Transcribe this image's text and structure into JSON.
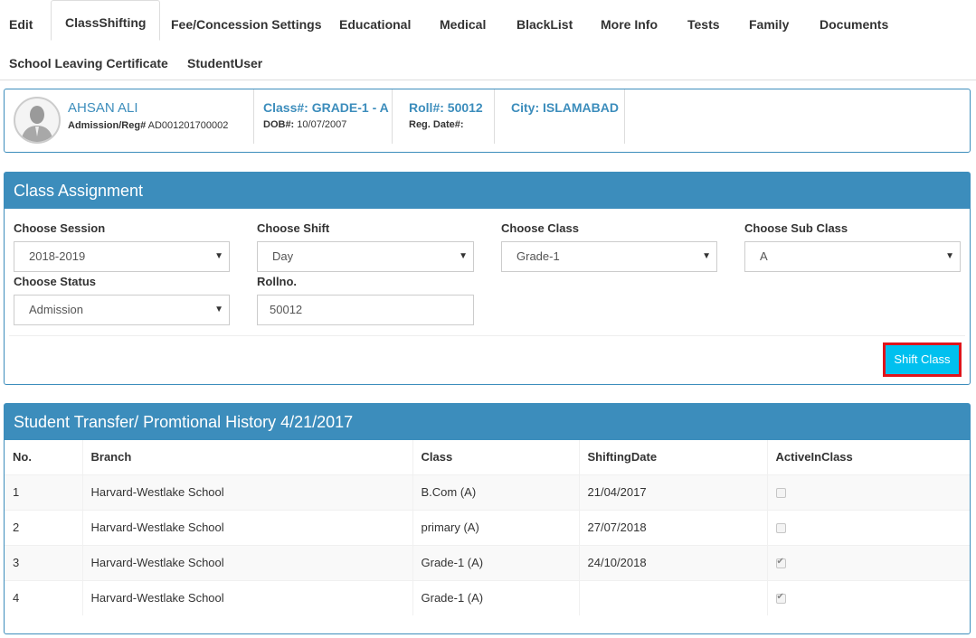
{
  "tabs": [
    {
      "label": "Edit"
    },
    {
      "label": "ClassShifting"
    },
    {
      "label": "Fee/Concession Settings"
    },
    {
      "label": "Educational"
    },
    {
      "label": "Medical"
    },
    {
      "label": "BlackList"
    },
    {
      "label": "More Info"
    },
    {
      "label": "Tests"
    },
    {
      "label": "Family"
    },
    {
      "label": "Documents"
    },
    {
      "label": "School Leaving Certificate"
    },
    {
      "label": "StudentUser"
    }
  ],
  "student": {
    "name": "AHSAN ALI",
    "admission_label": "Admission/Reg#",
    "admission_value": "AD001201700002",
    "class_label": "Class#: GRADE-1 - A",
    "dob_label": "DOB#:",
    "dob_value": "10/07/2007",
    "roll_label": "Roll#: 50012",
    "reg_date_label": "Reg. Date#:",
    "city_label": "City: ISLAMABAD"
  },
  "assignment": {
    "title": "Class Assignment",
    "session_label": "Choose Session",
    "session_value": "2018-2019",
    "shift_label": "Choose Shift",
    "shift_value": "Day",
    "class_label": "Choose Class",
    "class_value": "Grade-1",
    "subclass_label": "Choose Sub Class",
    "subclass_value": "A",
    "status_label": "Choose Status",
    "status_value": "Admission",
    "rollno_label": "Rollno.",
    "rollno_value": "50012",
    "shift_button": "Shift Class"
  },
  "history": {
    "title": "Student Transfer/ Promtional History 4/21/2017",
    "columns": [
      "No.",
      "Branch",
      "Class",
      "ShiftingDate",
      "ActiveInClass"
    ],
    "rows": [
      {
        "no": "1",
        "branch": "Harvard-Westlake School",
        "class": "B.Com (A)",
        "date": "21/04/2017",
        "active": false
      },
      {
        "no": "2",
        "branch": "Harvard-Westlake School",
        "class": "primary (A)",
        "date": "27/07/2018",
        "active": false
      },
      {
        "no": "3",
        "branch": "Harvard-Westlake School",
        "class": "Grade-1 (A)",
        "date": "24/10/2018",
        "active": true
      },
      {
        "no": "4",
        "branch": "Harvard-Westlake School",
        "class": "Grade-1 (A)",
        "date": "",
        "active": true
      }
    ]
  },
  "colors": {
    "primary": "#3c8dbc",
    "button": "#00c0ef",
    "highlight_border": "#e0141b"
  }
}
